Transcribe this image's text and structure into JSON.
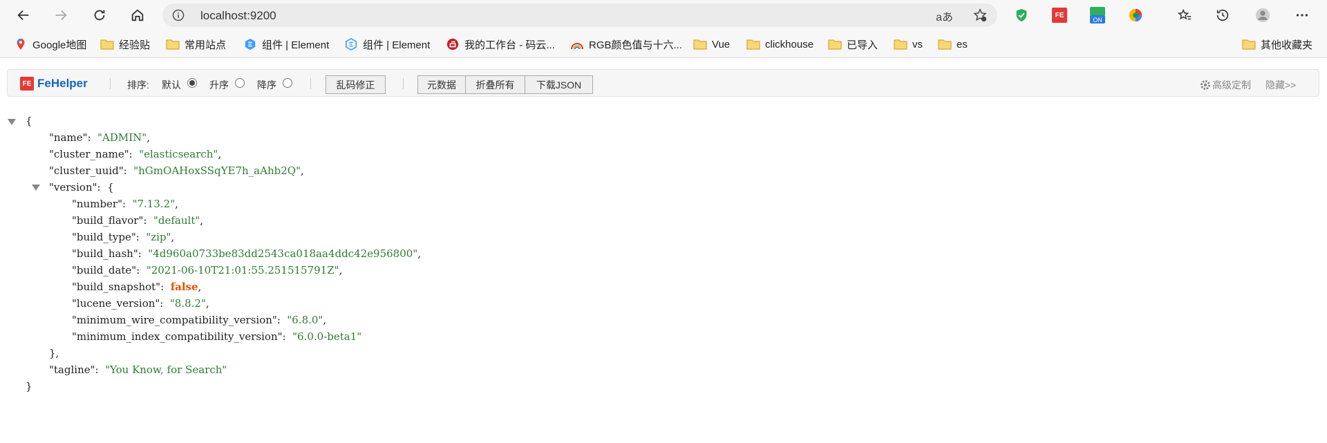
{
  "browser": {
    "url": "localhost:9200",
    "read_aloud": "aあ"
  },
  "bookmarks": [
    {
      "label": "Google地图",
      "icon": "google-maps-icon"
    },
    {
      "label": "经验贴",
      "icon": "folder-icon"
    },
    {
      "label": "常用站点",
      "icon": "folder-icon"
    },
    {
      "label": "组件 | Element",
      "icon": "element-icon"
    },
    {
      "label": "组件 | Element",
      "icon": "element-icon"
    },
    {
      "label": "我的工作台 - 码云...",
      "icon": "gitee-icon"
    },
    {
      "label": "RGB颜色值与十六...",
      "icon": "rainbow-icon"
    },
    {
      "label": "Vue",
      "icon": "folder-icon"
    },
    {
      "label": "clickhouse",
      "icon": "folder-icon"
    },
    {
      "label": "已导入",
      "icon": "folder-icon"
    },
    {
      "label": "vs",
      "icon": "folder-icon"
    },
    {
      "label": "es",
      "icon": "folder-icon"
    },
    {
      "label": "其他收藏夹",
      "icon": "folder-icon"
    }
  ],
  "fehelper": {
    "logo_mark": "FE",
    "title": "FeHelper",
    "sort_label": "排序:",
    "sort_options": [
      "默认",
      "升序",
      "降序"
    ],
    "sort_selected": "默认",
    "fix_encoding": "乱码修正",
    "raw_data": "元数据",
    "collapse_all": "折叠所有",
    "download_json": "下载JSON",
    "advanced": "高级定制",
    "hide": "隐藏>>"
  },
  "json": {
    "open_brace": "{",
    "close_brace": "}",
    "name_key": "\"name\"",
    "name_val": "\"ADMIN\"",
    "cluster_name_key": "\"cluster_name\"",
    "cluster_name_val": "\"elasticsearch\"",
    "cluster_uuid_key": "\"cluster_uuid\"",
    "cluster_uuid_val": "\"hGmOAHoxSSqYE7h_aAhb2Q\"",
    "version_key": "\"version\"",
    "number_key": "\"number\"",
    "number_val": "\"7.13.2\"",
    "build_flavor_key": "\"build_flavor\"",
    "build_flavor_val": "\"default\"",
    "build_type_key": "\"build_type\"",
    "build_type_val": "\"zip\"",
    "build_hash_key": "\"build_hash\"",
    "build_hash_val": "\"4d960a0733be83dd2543ca018aa4ddc42e956800\"",
    "build_date_key": "\"build_date\"",
    "build_date_val": "\"2021-06-10T21:01:55.251515791Z\"",
    "build_snapshot_key": "\"build_snapshot\"",
    "build_snapshot_val": "false",
    "lucene_version_key": "\"lucene_version\"",
    "lucene_version_val": "\"8.8.2\"",
    "min_wire_key": "\"minimum_wire_compatibility_version\"",
    "min_wire_val": "\"6.8.0\"",
    "min_index_key": "\"minimum_index_compatibility_version\"",
    "min_index_val": "\"6.0.0-beta1\"",
    "version_close": "},",
    "tagline_key": "\"tagline\"",
    "tagline_val": "\"You Know, for Search\""
  }
}
